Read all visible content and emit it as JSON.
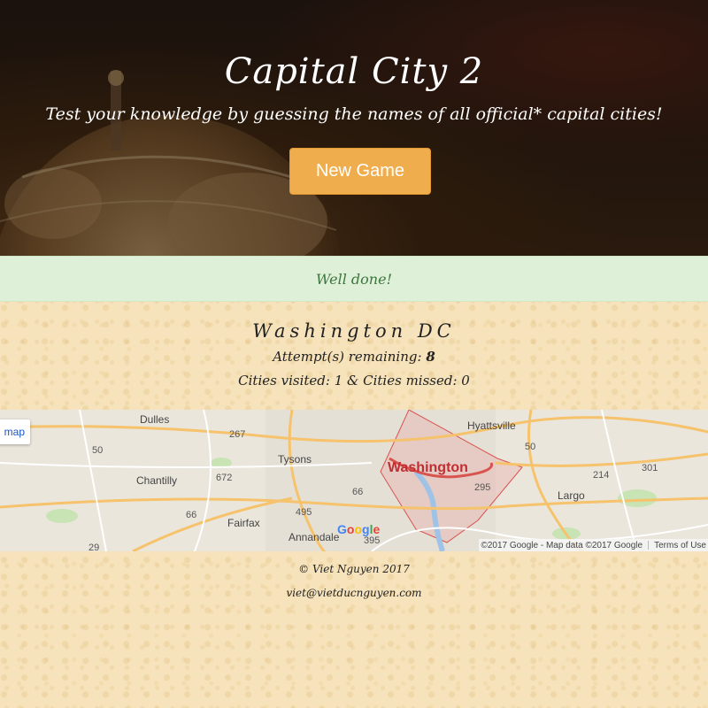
{
  "hero": {
    "title": "Capital City 2",
    "subtitle": "Test your knowledge by guessing the names of all official* capital cities!",
    "new_game_label": "New Game"
  },
  "alert": {
    "message": "Well done!"
  },
  "game": {
    "city": "Washington DC",
    "attempts_label": "Attempt(s) remaining:",
    "attempts_value": "8",
    "stats": "Cities visited: 1 & Cities missed: 0"
  },
  "map": {
    "map_type_label": "map",
    "highlight_label": "Washington",
    "place_labels": {
      "dulles": "Dulles",
      "tysons": "Tysons",
      "chantilly": "Chantilly",
      "fairfax": "Fairfax",
      "annandale": "Annandale",
      "hyattsville": "Hyattsville",
      "largo": "Largo"
    },
    "road_shields": {
      "r50a": "50",
      "r267": "267",
      "r672": "672",
      "r66a": "66",
      "r66b": "66",
      "r495": "495",
      "r395": "395",
      "r29": "29",
      "r50b": "50",
      "r214": "214",
      "r301": "301",
      "r295": "295"
    },
    "google_logo": "Google",
    "attribution": "©2017 Google - Map data ©2017 Google",
    "terms": "Terms of Use"
  },
  "footer": {
    "copyright": "© Viet Nguyen 2017",
    "email": "viet@vietducnguyen.com"
  },
  "colors": {
    "accent_button": "#efad4e",
    "alert_bg": "#dff0d8",
    "alert_text": "#3c763d",
    "paper": "#f6e3bb",
    "dc_highlight": "#c12e31"
  }
}
